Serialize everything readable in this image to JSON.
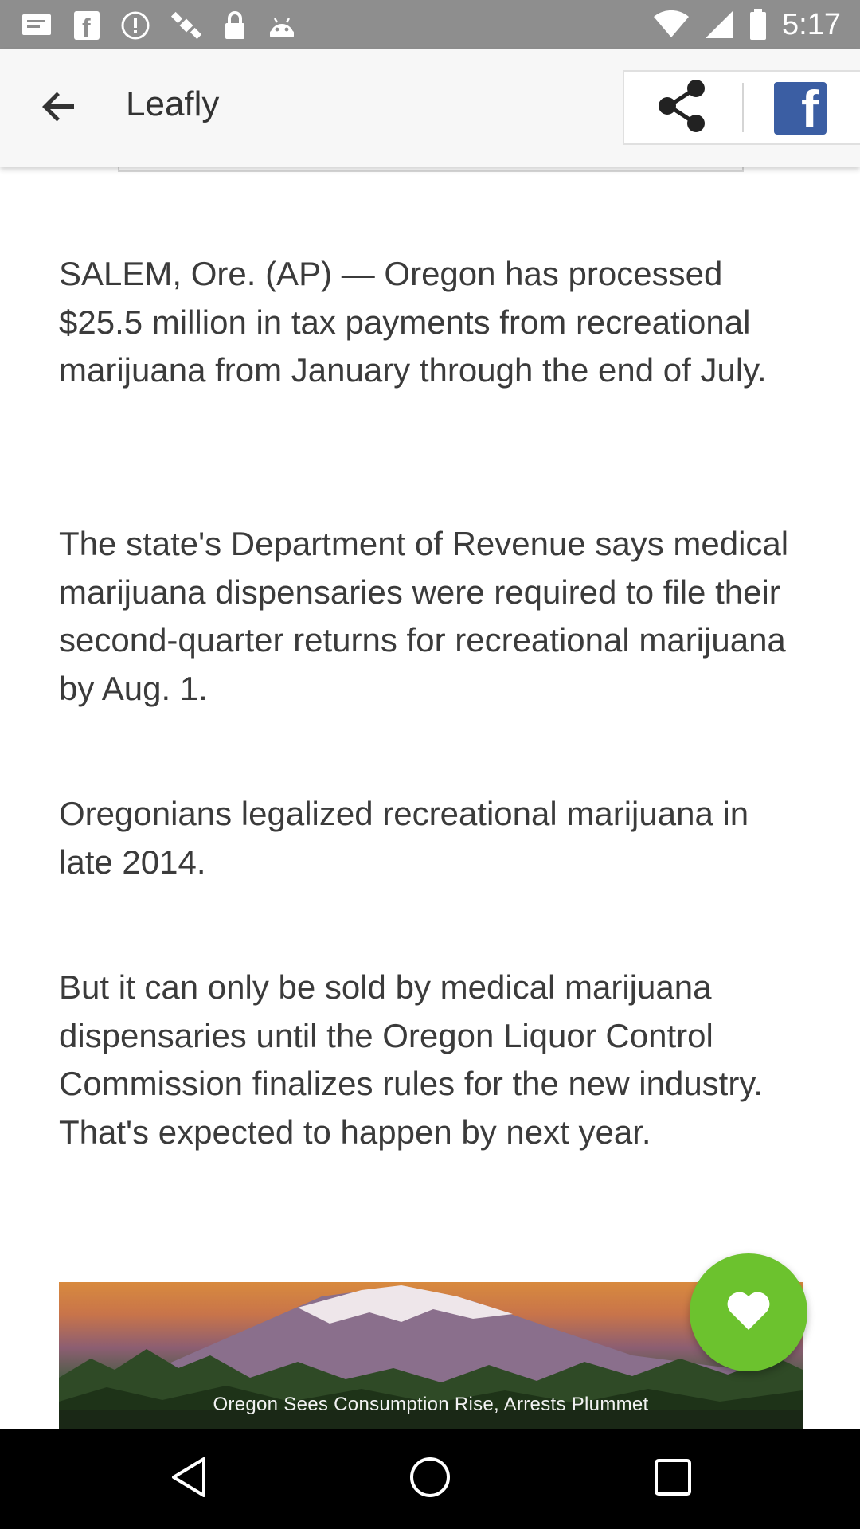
{
  "status_bar": {
    "time": "5:17",
    "icons_left": [
      "message-icon",
      "facebook-notification-icon",
      "alert-icon",
      "satellite-icon",
      "lock-icon",
      "android-icon"
    ]
  },
  "app_bar": {
    "title": "Leafly",
    "back_icon": "arrow-back-icon",
    "share_icon": "share-icon",
    "facebook_icon": "facebook-icon",
    "facebook_glyph": "f"
  },
  "article": {
    "paragraphs": [
      "SALEM, Ore. (AP) — Oregon has processed $25.5 million in tax payments from recreational marijuana from January through the end of July.",
      "The state's Department of Revenue says medical marijuana dispensaries were required to file their second-quarter returns for recreational marijuana by Aug. 1.",
      "Oregonians legalized recreational marijuana in late 2014.",
      "But it can only be sold by medical marijuana dispensaries until the Oregon Liquor Control Commission finalizes rules for the new industry. That's expected to happen by next year."
    ],
    "image_caption": "Oregon Sees Consumption Rise, Arrests Plummet"
  },
  "fab": {
    "icon": "heart-icon",
    "color": "#6cc22e"
  },
  "colors": {
    "status_bar": "#8e8e8e",
    "app_bar": "#f7f7f7",
    "text": "#3b3b3b",
    "facebook": "#3b5ea3"
  },
  "nav_bar": {
    "icons": [
      "back-triangle-icon",
      "home-circle-icon",
      "recents-square-icon"
    ]
  }
}
